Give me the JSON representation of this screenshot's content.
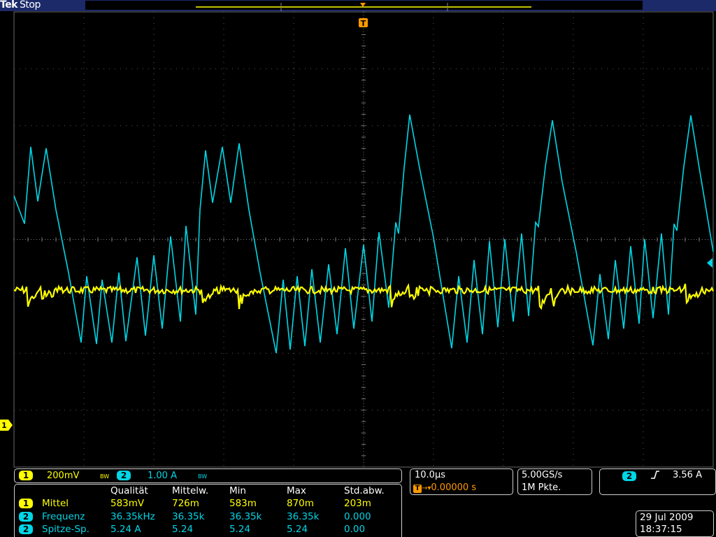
{
  "header": {
    "brand": "Tek",
    "run_state": "Stop",
    "trigger_marker": "T"
  },
  "ch1_marker": "1",
  "channel_settings": {
    "ch1": {
      "badge": "1",
      "scale": "200mV",
      "bw": "BW"
    },
    "ch2": {
      "badge": "2",
      "scale": "1.00 A",
      "bw": "BW"
    }
  },
  "timebase": {
    "scale": "10.0µs",
    "trigger_delay": "0.00000 s",
    "trigger_icon": "T"
  },
  "acquisition": {
    "sample_rate": "5.00GS/s",
    "record_length": "1M Pkte."
  },
  "trigger": {
    "source": "2",
    "slope_symbol": "⌐",
    "level": "3.56 A"
  },
  "measurements": {
    "headers": [
      "Qualität",
      "Mittelw.",
      "Min",
      "Max",
      "Std.abw."
    ],
    "rows": [
      {
        "ch": "1",
        "name": "Mittel",
        "values": [
          "583mV",
          "726m",
          "583m",
          "870m",
          "203m"
        ]
      },
      {
        "ch": "2",
        "name": "Frequenz",
        "values": [
          "36.35kHz",
          "36.35k",
          "36.35k",
          "36.35k",
          "0.000"
        ]
      },
      {
        "ch": "2",
        "name": "Spitze-Sp.",
        "values": [
          "5.24 A",
          "5.24",
          "5.24",
          "5.24",
          "0.00"
        ]
      }
    ]
  },
  "datetime": {
    "date": "29 Jul  2009",
    "time": "18:37:15"
  },
  "colors": {
    "ch1": "#ffff00",
    "ch2": "#00d6e6",
    "trigger": "#ff9900",
    "header_bg": "#1c2a6a"
  }
}
